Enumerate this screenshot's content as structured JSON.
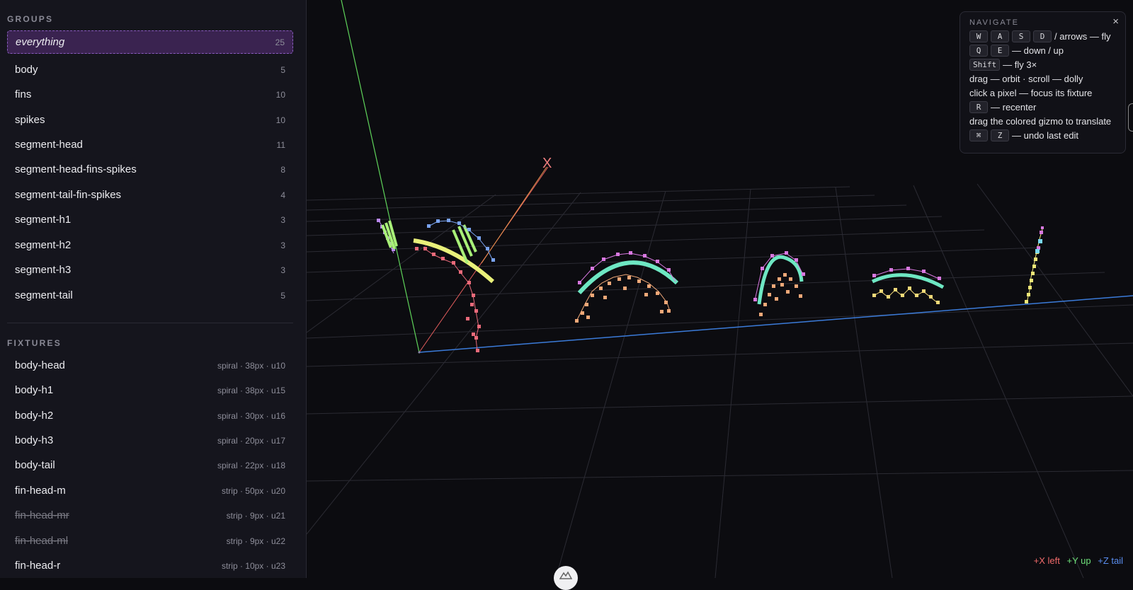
{
  "groups": {
    "title": "GROUPS",
    "items": [
      {
        "name": "everything",
        "count": "25"
      },
      {
        "name": "body",
        "count": "5"
      },
      {
        "name": "fins",
        "count": "10"
      },
      {
        "name": "spikes",
        "count": "10"
      },
      {
        "name": "segment-head",
        "count": "11"
      },
      {
        "name": "segment-head-fins-spikes",
        "count": "8"
      },
      {
        "name": "segment-tail-fin-spikes",
        "count": "4"
      },
      {
        "name": "segment-h1",
        "count": "3"
      },
      {
        "name": "segment-h2",
        "count": "3"
      },
      {
        "name": "segment-h3",
        "count": "3"
      },
      {
        "name": "segment-tail",
        "count": "5"
      }
    ]
  },
  "fixtures": {
    "title": "FIXTURES",
    "items": [
      {
        "name": "body-head",
        "meta": "spiral · 38px · u10"
      },
      {
        "name": "body-h1",
        "meta": "spiral · 38px · u15"
      },
      {
        "name": "body-h2",
        "meta": "spiral · 30px · u16"
      },
      {
        "name": "body-h3",
        "meta": "spiral · 20px · u17"
      },
      {
        "name": "body-tail",
        "meta": "spiral · 22px · u18"
      },
      {
        "name": "fin-head-m",
        "meta": "strip · 50px · u20"
      },
      {
        "name": "fin-head-mr",
        "meta": "strip · 9px · u21"
      },
      {
        "name": "fin-head-ml",
        "meta": "strip · 9px · u22"
      },
      {
        "name": "fin-head-r",
        "meta": "strip · 10px · u23"
      }
    ]
  },
  "navigate": {
    "title": "NAVIGATE",
    "close": "×",
    "keys": {
      "w": "W",
      "a": "A",
      "s": "S",
      "d": "D",
      "q": "Q",
      "e": "E",
      "shift": "Shift",
      "r": "R",
      "cmd": "⌘",
      "z": "Z"
    },
    "lines": {
      "fly": "/ arrows — fly",
      "updown": "— down / up",
      "shift": "— fly 3×",
      "drag": "drag — orbit · scroll — dolly",
      "click": "click a pixel — focus its fixture",
      "recenter": "— recenter",
      "gizmo": "drag the colored gizmo to translate",
      "undo": "— undo last edit"
    }
  },
  "axes": {
    "x_label": "X",
    "legend_x": "+X left",
    "legend_y": "+Y up",
    "legend_z": "+Z tail"
  },
  "colors": {
    "x_axis": "#e35d5d",
    "y_axis": "#5fd35a",
    "z_axis": "#3b7bd9",
    "active_group": "#3a2350",
    "accent_mint": "#6ee7c3",
    "accent_yellow": "#e9f07a"
  }
}
